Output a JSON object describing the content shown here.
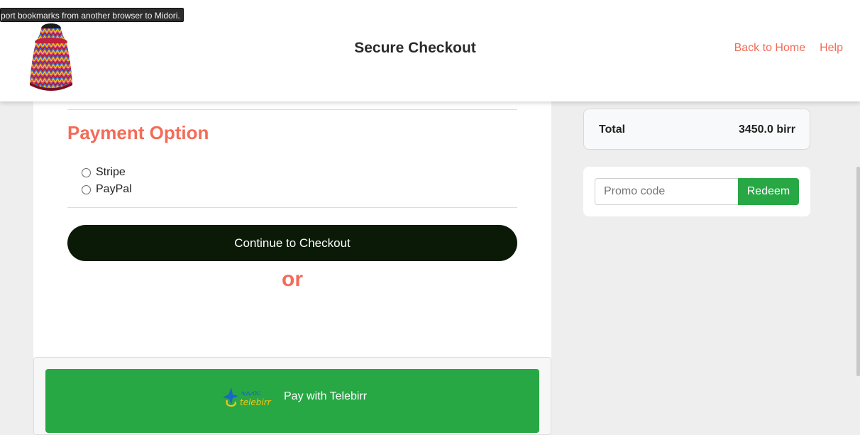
{
  "tooltip": "port bookmarks from another browser to Midori.",
  "header": {
    "title": "Secure Checkout",
    "nav": {
      "home": "Back to Home",
      "help": "Help"
    }
  },
  "payment": {
    "heading": "Payment Option",
    "options": [
      "Stripe",
      "PayPal"
    ],
    "checkout_label": "Continue to Checkout",
    "or_label": "or"
  },
  "telebirr": {
    "logo_amharic": "ቴሌብር",
    "logo_text": "telebirr",
    "label": "Pay with Telebirr"
  },
  "summary": {
    "total_label": "Total",
    "total_value": "3450.0 birr"
  },
  "promo": {
    "placeholder": "Promo code",
    "redeem_label": "Redeem"
  },
  "colors": {
    "accent": "#f46b57",
    "success": "#28a745",
    "dark_button": "#0a1a07"
  }
}
